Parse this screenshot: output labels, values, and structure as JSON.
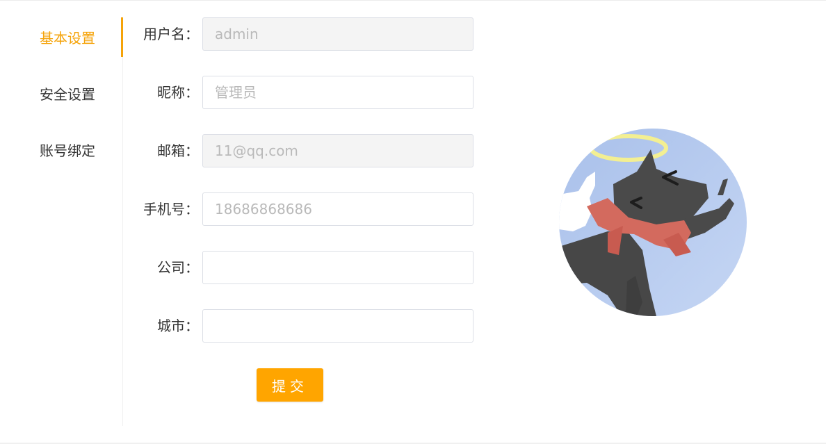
{
  "menu": {
    "items": [
      {
        "label": "基本设置",
        "active": true
      },
      {
        "label": "安全设置",
        "active": false
      },
      {
        "label": "账号绑定",
        "active": false
      }
    ]
  },
  "form": {
    "fields": [
      {
        "label": "用户名：",
        "value": "admin",
        "placeholder": "",
        "disabled": true
      },
      {
        "label": "昵称：",
        "value": "",
        "placeholder": "管理员",
        "disabled": false
      },
      {
        "label": "邮箱：",
        "value": "11@qq.com",
        "placeholder": "",
        "disabled": true
      },
      {
        "label": "手机号：",
        "value": "",
        "placeholder": "18686868686",
        "disabled": false
      },
      {
        "label": "公司：",
        "value": "",
        "placeholder": "",
        "disabled": false
      },
      {
        "label": "城市：",
        "value": "",
        "placeholder": "",
        "disabled": false
      }
    ],
    "submit_label": "提交"
  },
  "avatar": {
    "icon": "cat-avatar",
    "accent": "#f5a309",
    "button_color": "#ffa500"
  }
}
